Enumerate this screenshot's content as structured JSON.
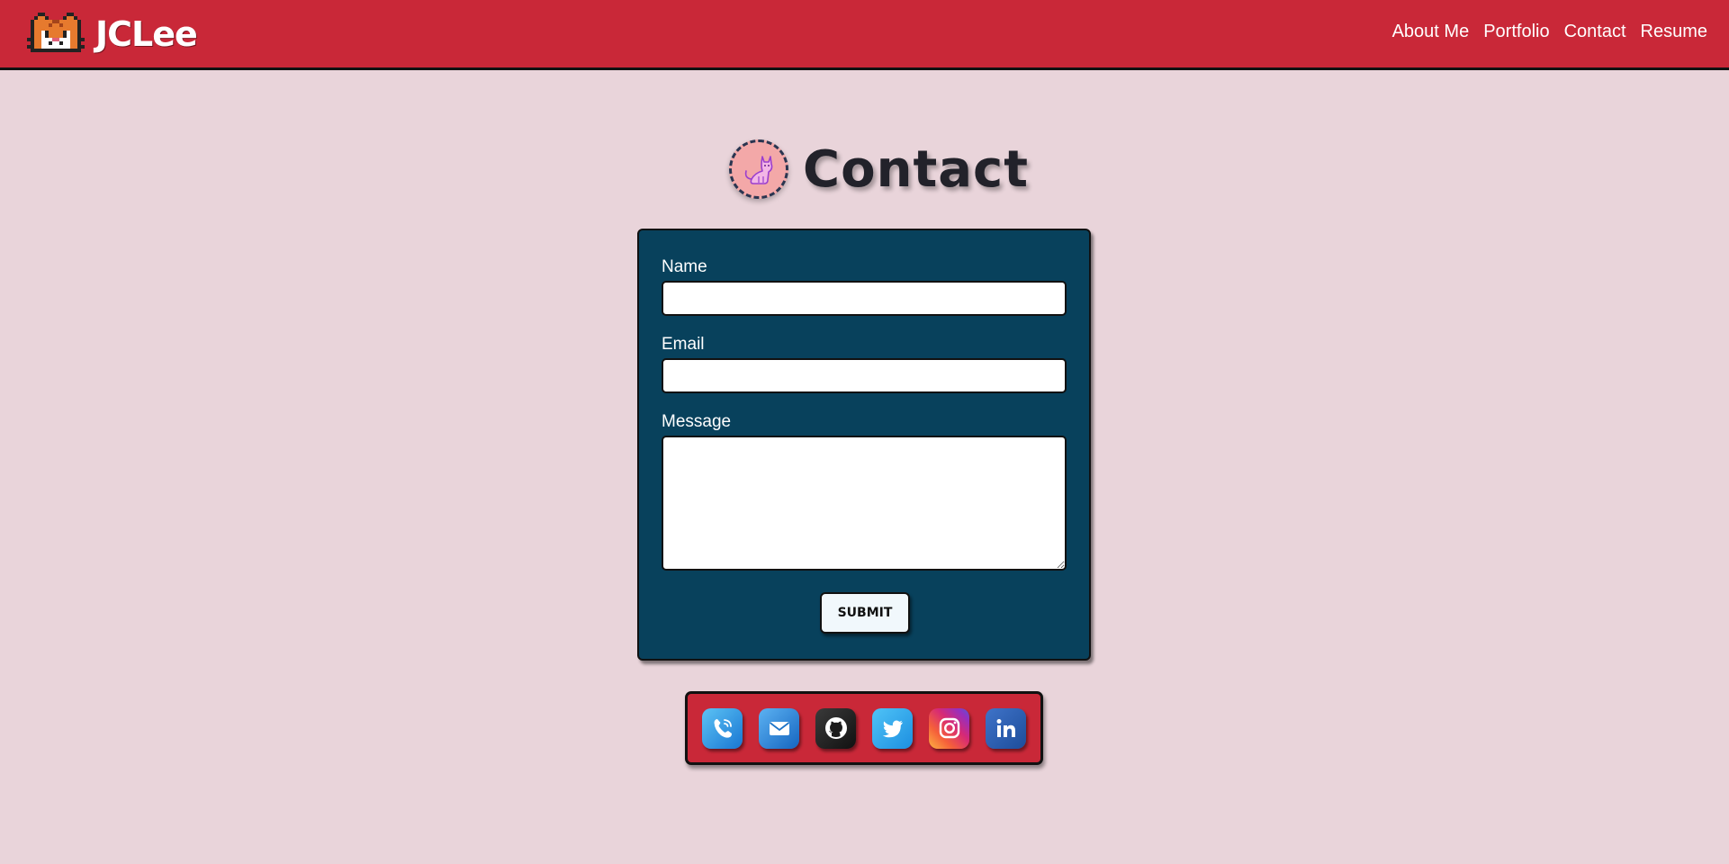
{
  "navbar": {
    "brand": "JCLee",
    "brand_icon": "pixel-cat-logo",
    "links": [
      "About Me",
      "Portfolio",
      "Contact",
      "Resume"
    ]
  },
  "page": {
    "title": "Contact",
    "title_icon": "pink-cat-icon"
  },
  "form": {
    "name_label": "Name",
    "name_value": "",
    "email_label": "Email",
    "email_value": "",
    "message_label": "Message",
    "message_value": "",
    "submit_label": "SUBMIT"
  },
  "social": [
    {
      "name": "phone-icon"
    },
    {
      "name": "email-icon"
    },
    {
      "name": "github-icon"
    },
    {
      "name": "twitter-icon"
    },
    {
      "name": "instagram-icon"
    },
    {
      "name": "linkedin-icon"
    }
  ],
  "colors": {
    "background": "#e9d4da",
    "accent_red": "#c92838",
    "form_navy": "#08415c"
  }
}
